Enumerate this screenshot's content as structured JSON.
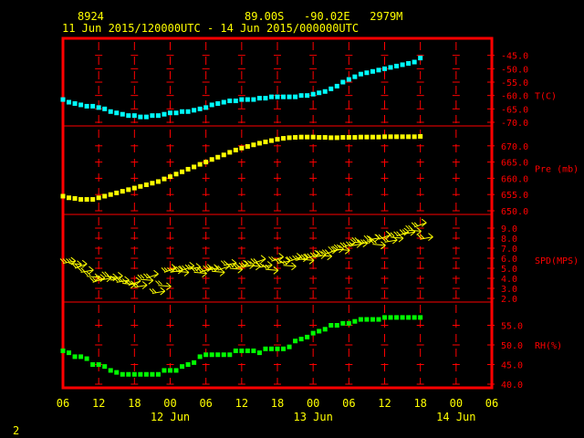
{
  "header": {
    "station": "8924",
    "location": "89.00S   -90.02E   2979M",
    "period": "11 Jun 2015/120000UTC - 14 Jun 2015/000000UTC"
  },
  "footer_mark": "2",
  "colors": {
    "frame": "#ff0000",
    "grid": "#ff0000",
    "label": "#ffff00",
    "axis_label": "#ff0000",
    "temp": "#00ffff",
    "pres": "#ffff00",
    "wind": "#ffff00",
    "rh": "#00ff00"
  },
  "chart_data": {
    "type": "scatter",
    "x_axis": {
      "ticks": [
        "06",
        "12",
        "18",
        "00",
        "06",
        "12",
        "18",
        "00",
        "06",
        "12",
        "18",
        "00",
        "06"
      ],
      "day_labels": [
        "12 Jun",
        "13 Jun",
        "14 Jun"
      ],
      "range_hours": [
        0,
        72
      ],
      "range_labels": [
        "11 Jun 06",
        "14 Jun 06"
      ]
    },
    "panels": [
      {
        "name": "T(C)",
        "ticks": [
          -45.0,
          -50.0,
          -55.0,
          -60.0,
          -65.0,
          -70.0
        ],
        "tick_labels": [
          "-45.0",
          "-50.0",
          "-55.0",
          "-60.0",
          "-65.0",
          "-70.0"
        ],
        "range": [
          -70,
          -40
        ],
        "x": [
          0,
          1,
          2,
          3,
          4,
          5,
          6,
          7,
          8,
          9,
          10,
          11,
          12,
          13,
          14,
          15,
          16,
          17,
          18,
          19,
          20,
          21,
          22,
          23,
          24,
          25,
          26,
          27,
          28,
          29,
          30,
          31,
          32,
          33,
          34,
          35,
          36,
          37,
          38,
          39,
          40,
          41,
          42,
          43,
          44,
          45,
          46,
          47,
          48,
          49,
          50,
          51,
          52,
          53,
          54,
          55,
          56,
          57,
          58,
          59,
          60
        ],
        "values": [
          -61.5,
          -62.5,
          -63.0,
          -63.5,
          -64.0,
          -64.0,
          -64.5,
          -65.0,
          -66.0,
          -66.5,
          -67.0,
          -67.5,
          -67.5,
          -68.0,
          -68.0,
          -67.5,
          -67.5,
          -67.0,
          -66.5,
          -66.5,
          -66.0,
          -66.0,
          -65.5,
          -65.0,
          -64.5,
          -63.5,
          -63.0,
          -62.5,
          -62.0,
          -62.0,
          -61.5,
          -61.5,
          -61.5,
          -61.0,
          -61.0,
          -60.5,
          -60.5,
          -60.5,
          -60.5,
          -60.5,
          -60.0,
          -60.0,
          -59.5,
          -59.0,
          -58.5,
          -57.5,
          -56.5,
          -55.0,
          -54.0,
          -53.0,
          -52.0,
          -51.5,
          -51.0,
          -50.5,
          -50.0,
          -49.5,
          -49.0,
          -48.5,
          -48.0,
          -47.5,
          -46.0
        ]
      },
      {
        "name": "Pre (mb)",
        "ticks": [
          670.0,
          665.0,
          660.0,
          655.0,
          650.0
        ],
        "tick_labels": [
          "670.0",
          "665.0",
          "660.0",
          "655.0",
          "650.0"
        ],
        "range": [
          650,
          675
        ],
        "x": [
          0,
          1,
          2,
          3,
          4,
          5,
          6,
          7,
          8,
          9,
          10,
          11,
          12,
          13,
          14,
          15,
          16,
          17,
          18,
          19,
          20,
          21,
          22,
          23,
          24,
          25,
          26,
          27,
          28,
          29,
          30,
          31,
          32,
          33,
          34,
          35,
          36,
          37,
          38,
          39,
          40,
          41,
          42,
          43,
          44,
          45,
          46,
          47,
          48,
          49,
          50,
          51,
          52,
          53,
          54,
          55,
          56,
          57,
          58,
          59,
          60
        ],
        "values": [
          654.5,
          654.0,
          653.8,
          653.5,
          653.5,
          653.5,
          654.0,
          654.5,
          655.0,
          655.5,
          656.0,
          656.5,
          657.0,
          657.5,
          658.0,
          658.5,
          659.0,
          659.8,
          660.5,
          661.3,
          662.0,
          662.8,
          663.5,
          664.3,
          665.0,
          665.8,
          666.5,
          667.2,
          668.0,
          668.7,
          669.3,
          669.8,
          670.3,
          670.8,
          671.2,
          671.6,
          672.0,
          672.3,
          672.5,
          672.6,
          672.7,
          672.7,
          672.7,
          672.6,
          672.6,
          672.5,
          672.5,
          672.6,
          672.6,
          672.6,
          672.7,
          672.7,
          672.7,
          672.7,
          672.8,
          672.8,
          672.8,
          672.8,
          672.8,
          672.8,
          672.9
        ]
      },
      {
        "name": "SPD(MPS)",
        "ticks": [
          9.0,
          8.0,
          7.0,
          6.0,
          5.0,
          4.0,
          3.0,
          2.0
        ],
        "tick_labels": [
          "9.0",
          "8.0",
          "7.0",
          "6.0",
          "5.0",
          "4.0",
          "3.0",
          "2.0"
        ],
        "range": [
          2,
          10
        ],
        "x": [
          0,
          1,
          2,
          3,
          4,
          5,
          6,
          7,
          8,
          9,
          10,
          11,
          12,
          13,
          14,
          15,
          16,
          17,
          18,
          19,
          20,
          21,
          22,
          23,
          24,
          25,
          26,
          27,
          28,
          29,
          30,
          31,
          32,
          33,
          34,
          35,
          36,
          37,
          38,
          39,
          40,
          41,
          42,
          43,
          44,
          45,
          46,
          47,
          48,
          49,
          50,
          51,
          52,
          53,
          54,
          55,
          56,
          57,
          58,
          59,
          60
        ],
        "values": [
          5.5,
          5.5,
          5.0,
          4.6,
          4.2,
          3.6,
          3.8,
          4.2,
          3.8,
          3.6,
          3.5,
          3.3,
          3.1,
          3.9,
          4.0,
          2.5,
          3.3,
          4.6,
          4.6,
          4.7,
          4.8,
          4.9,
          4.6,
          4.6,
          4.8,
          4.7,
          4.8,
          5.3,
          5.0,
          5.0,
          5.1,
          5.3,
          5.5,
          5.1,
          4.9,
          5.7,
          5.5,
          5.3,
          5.7,
          5.8,
          5.9,
          6.0,
          6.1,
          6.3,
          6.4,
          6.7,
          6.9,
          7.1,
          7.2,
          7.6,
          7.4,
          7.8,
          7.4,
          7.9,
          7.6,
          8.1,
          8.2,
          8.4,
          8.8,
          9.1,
          7.9
        ]
      },
      {
        "name": "RH(%)",
        "ticks": [
          55.0,
          50.0,
          45.0,
          40.0
        ],
        "tick_labels": [
          "55.0",
          "50.0",
          "45.0",
          "40.0"
        ],
        "range": [
          40,
          60
        ],
        "x": [
          0,
          1,
          2,
          3,
          4,
          5,
          6,
          7,
          8,
          9,
          10,
          11,
          12,
          13,
          14,
          15,
          16,
          17,
          18,
          19,
          20,
          21,
          22,
          23,
          24,
          25,
          26,
          27,
          28,
          29,
          30,
          31,
          32,
          33,
          34,
          35,
          36,
          37,
          38,
          39,
          40,
          41,
          42,
          43,
          44,
          45,
          46,
          47,
          48,
          49,
          50,
          51,
          52,
          53,
          54,
          55,
          56,
          57,
          58,
          59,
          60
        ],
        "values": [
          48.5,
          48.0,
          47.0,
          47.0,
          46.5,
          45.0,
          45.0,
          44.5,
          43.5,
          43.0,
          42.5,
          42.5,
          42.5,
          42.5,
          42.5,
          42.5,
          42.5,
          43.5,
          43.5,
          43.5,
          44.5,
          45.0,
          45.5,
          47.0,
          47.5,
          47.5,
          47.5,
          47.5,
          47.5,
          48.5,
          48.5,
          48.5,
          48.5,
          48.0,
          49.0,
          49.0,
          49.0,
          49.0,
          49.5,
          51.0,
          51.5,
          52.0,
          53.0,
          53.5,
          54.0,
          55.0,
          55.0,
          55.5,
          55.5,
          56.0,
          56.5,
          56.5,
          56.5,
          56.5,
          57.0,
          57.0,
          57.0,
          57.0,
          57.0,
          57.0,
          57.0
        ]
      }
    ]
  }
}
